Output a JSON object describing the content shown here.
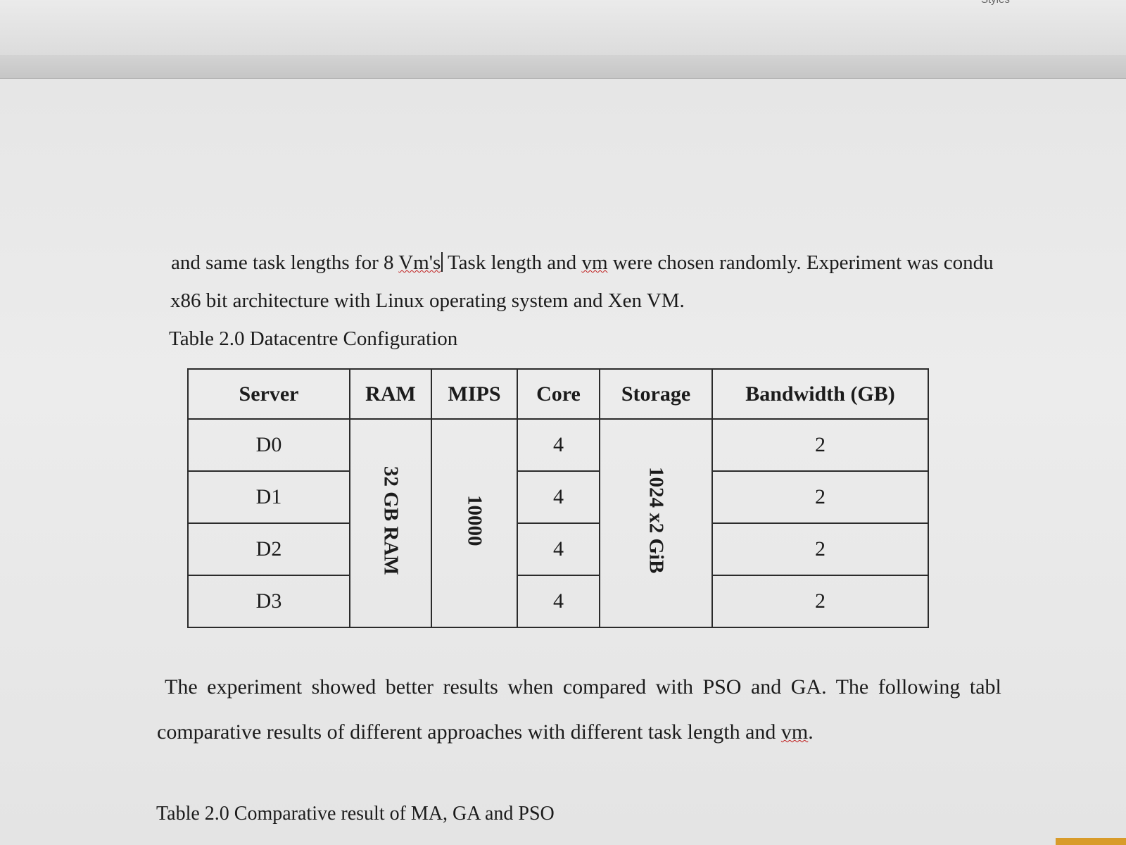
{
  "app": {
    "styles_label": "Styles"
  },
  "document": {
    "para1": {
      "before": "and same task lengths for 8 ",
      "vms": "Vm's",
      "middle": " Task length and ",
      "vm": "vm",
      "after": " were chosen randomly. Experiment was condu"
    },
    "para2": "x86 bit architecture with Linux operating system and Xen VM.",
    "table1_caption": "Table 2.0 Datacentre Configuration",
    "table1": {
      "headers": [
        "Server",
        "RAM",
        "MIPS",
        "Core",
        "Storage",
        "Bandwidth (GB)"
      ],
      "rows": [
        {
          "server": "D0",
          "core": "4",
          "bandwidth": "2"
        },
        {
          "server": "D1",
          "core": "4",
          "bandwidth": "2"
        },
        {
          "server": "D2",
          "core": "4",
          "bandwidth": "2"
        },
        {
          "server": "D3",
          "core": "4",
          "bandwidth": "2"
        }
      ],
      "ram_merged": "32 GB RAM",
      "mips_merged": "10000",
      "storage_merged": "1024 x2 GiB"
    },
    "para3": "The experiment showed better results when compared with PSO and GA. The following tabl",
    "para4": {
      "before": "comparative results of different approaches with different task length and ",
      "vm": "vm",
      "after": "."
    },
    "table2_caption": "Table 2.0 Comparative result of MA, GA and PSO"
  }
}
